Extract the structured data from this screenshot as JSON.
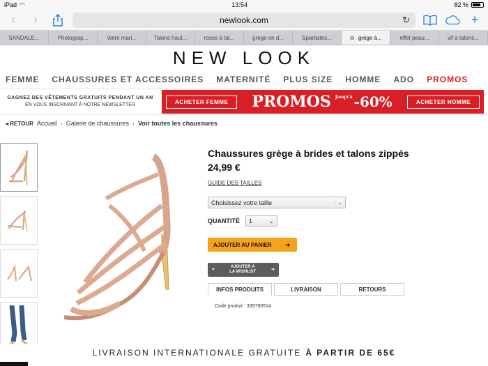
{
  "status": {
    "device": "iPad",
    "time": "13:54",
    "battery": "82 %",
    "battery_level": 0.82
  },
  "browser": {
    "url": "newlook.com",
    "tabs": [
      {
        "label": "SANDALE..."
      },
      {
        "label": "Photograp..."
      },
      {
        "label": "Votre mari..."
      },
      {
        "label": "Talons haut..."
      },
      {
        "label": "roses à tal..."
      },
      {
        "label": "grège en d..."
      },
      {
        "label": "Spartiates..."
      },
      {
        "label": "grège à...",
        "active": true
      },
      {
        "label": "effet peau..."
      },
      {
        "label": "vif à talons..."
      }
    ]
  },
  "site": {
    "logo": "NEW LOOK",
    "nav": [
      "FEMME",
      "CHAUSSURES ET ACCESSOIRES",
      "MATERNITÉ",
      "PLUS SIZE",
      "HOMME",
      "ADO",
      "PROMOS"
    ],
    "newsletter_line1": "GAGNEZ DES VÊTEMENTS GRATUITS PENDANT UN AN",
    "newsletter_line2": "EN VOUS INSCRIVANT À NOTRE NEWSLETTER",
    "promo_btn_women": "ACHETER FEMME",
    "promo_title": "PROMOS",
    "promo_small": "Jusqu'à",
    "promo_discount": "-60%",
    "promo_btn_men": "ACHETER HOMME"
  },
  "breadcrumb": {
    "back": "◂ RETOUR",
    "items": [
      "Accueil",
      "Galerie de chaussures",
      "Voir toutes les chaussures"
    ]
  },
  "product": {
    "title": "Chaussures grège à brides et talons zippés",
    "price": "24,99 €",
    "size_guide": "GUIDE DES TAILLES",
    "size_select": "Choisissez votre taille",
    "qty_label": "QUANTITÉ",
    "qty_value": "1",
    "add_to_cart": "AJOUTER AU PANIER",
    "wishlist_line1": "AJOUTER À",
    "wishlist_line2": "LA WISHLIST",
    "tabs": [
      "INFOS PRODUITS",
      "LIVRAISON",
      "RETOURS"
    ],
    "code": "Code produit : 339790514"
  },
  "footer": {
    "text": "LIVRAISON INTERNATIONALE GRATUITE",
    "bold": "À PARTIR DE 65€"
  },
  "colors": {
    "accent": "#1a7cf5",
    "promo_red": "#d91f26",
    "cart_orange": "#f7a21b",
    "shoe_nude": "#d8a58c"
  }
}
